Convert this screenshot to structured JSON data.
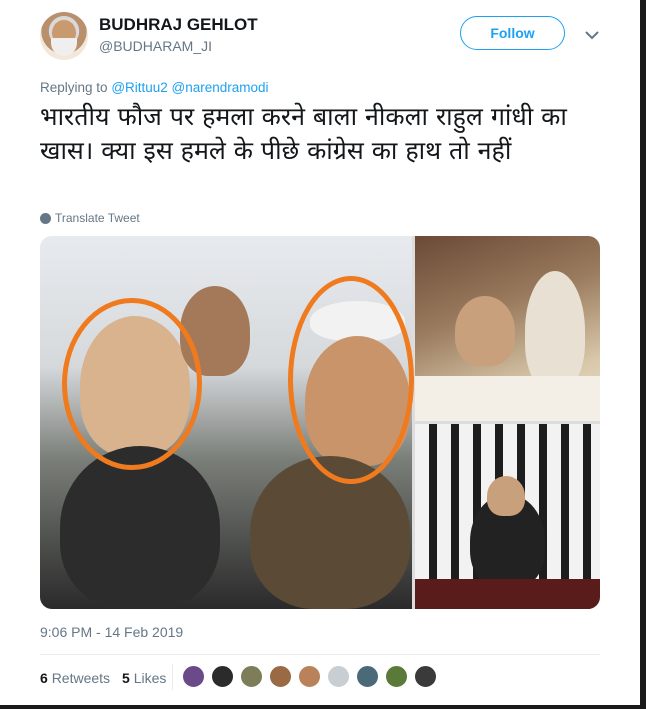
{
  "header": {
    "name": "BUDHRAJ GEHLOT",
    "handle": "@BUDHARAM_JI",
    "follow_label": "Follow"
  },
  "reply": {
    "prefix": "Replying to",
    "mentions": "@Rittuu2 @narendramodi"
  },
  "tweet": {
    "text": "भारतीय फौज पर हमला करने बाला नीकला राहुल गांधी का खास। क्या इस हमले के पीछे कांग्रेस का हाथ तो नहीं",
    "translate_label": "Translate Tweet",
    "timestamp": "9:06 PM - 14 Feb 2019"
  },
  "stats": {
    "retweets_count": "6",
    "retweets_label": "Retweets",
    "likes_count": "5",
    "likes_label": "Likes"
  },
  "likers": [
    {
      "color": "#6b4a8a"
    },
    {
      "color": "#2b2b2b"
    },
    {
      "color": "#7d7d5a"
    },
    {
      "color": "#9a6a45"
    },
    {
      "color": "#b9825a"
    },
    {
      "color": "#c9ced3"
    },
    {
      "color": "#4a6a7a"
    },
    {
      "color": "#5a7a3a"
    },
    {
      "color": "#3a3a3a"
    }
  ],
  "colors": {
    "accent": "#1da1f2",
    "secondary_text": "#657786",
    "circle_highlight": "#f07a1e"
  }
}
